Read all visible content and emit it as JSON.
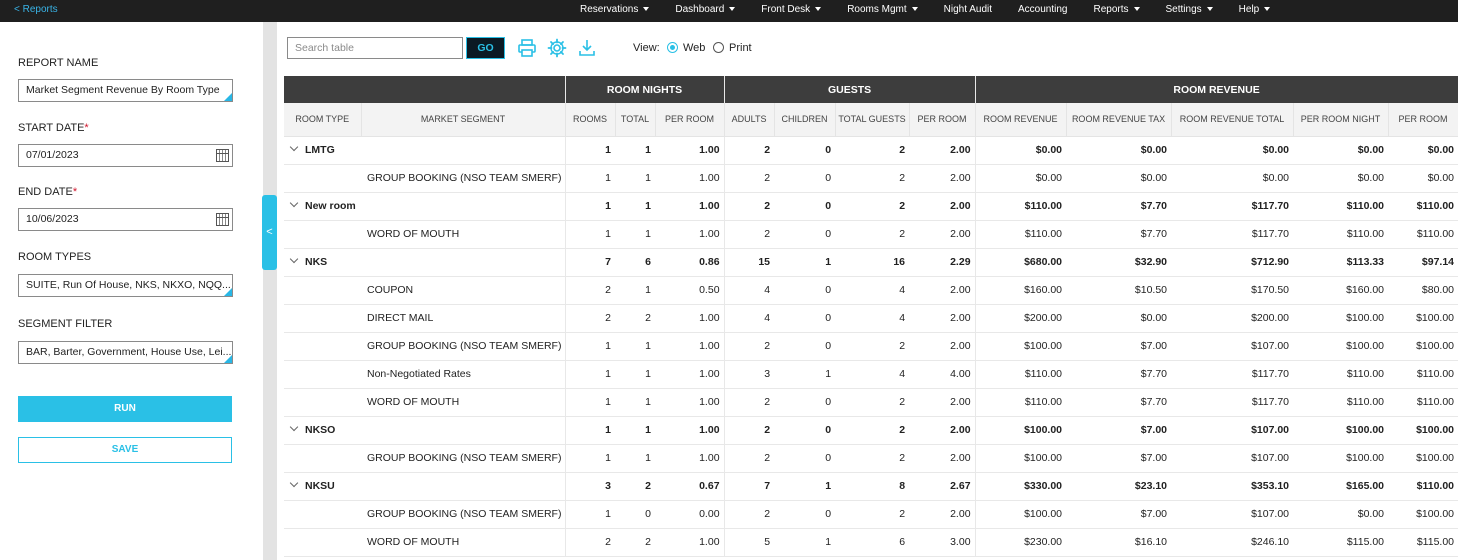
{
  "nav": {
    "back": "< Reports",
    "items": [
      "Reservations",
      "Dashboard",
      "Front Desk",
      "Rooms Mgmt",
      "Night Audit",
      "Accounting",
      "Reports",
      "Settings",
      "Help"
    ],
    "has_caret": [
      true,
      true,
      true,
      true,
      false,
      false,
      true,
      true,
      true
    ]
  },
  "sidebar": {
    "report_name_label": "REPORT NAME",
    "report_name_value": "Market Segment Revenue By Room Type",
    "start_date_label": "START DATE",
    "start_date_value": "07/01/2023",
    "end_date_label": "END DATE",
    "end_date_value": "10/06/2023",
    "required_mark": "*",
    "room_types_label": "ROOM TYPES",
    "room_types_value": "SUITE, Run Of House, NKS, NKXO, NQQ...",
    "segment_filter_label": "SEGMENT FILTER",
    "segment_filter_value": "BAR, Barter, Government, House Use, Lei...",
    "run_label": "RUN",
    "save_label": "SAVE",
    "collapse_glyph": "<"
  },
  "toolbar": {
    "search_placeholder": "Search table",
    "go_label": "GO",
    "view_label": "View:",
    "view_options": [
      "Web",
      "Print"
    ],
    "view_selected": "Web"
  },
  "colors": {
    "accent": "#2ac0e6",
    "nav_bg": "#1f1f1f",
    "header_bg": "#3d3d3d",
    "required": "#d0142b"
  },
  "table": {
    "groups": [
      "ROOM NIGHTS",
      "GUESTS",
      "ROOM REVENUE"
    ],
    "columns": [
      "ROOM TYPE",
      "MARKET SEGMENT",
      "ROOMS",
      "TOTAL",
      "PER ROOM",
      "ADULTS",
      "CHILDREN",
      "TOTAL GUESTS",
      "PER ROOM",
      "ROOM REVENUE",
      "ROOM REVENUE TAX",
      "ROOM REVENUE TOTAL",
      "PER ROOM NIGHT",
      "PER ROOM"
    ],
    "rows": [
      {
        "type": "parent",
        "room_type": "LMTG",
        "segment": "",
        "v": [
          "1",
          "1",
          "1.00",
          "2",
          "0",
          "2",
          "2.00",
          "$0.00",
          "$0.00",
          "$0.00",
          "$0.00",
          "$0.00"
        ]
      },
      {
        "type": "child",
        "room_type": "",
        "segment": "GROUP BOOKING (NSO TEAM SMERF)",
        "v": [
          "1",
          "1",
          "1.00",
          "2",
          "0",
          "2",
          "2.00",
          "$0.00",
          "$0.00",
          "$0.00",
          "$0.00",
          "$0.00"
        ]
      },
      {
        "type": "parent",
        "room_type": "New room",
        "segment": "",
        "v": [
          "1",
          "1",
          "1.00",
          "2",
          "0",
          "2",
          "2.00",
          "$110.00",
          "$7.70",
          "$117.70",
          "$110.00",
          "$110.00"
        ]
      },
      {
        "type": "child",
        "room_type": "",
        "segment": "WORD OF MOUTH",
        "v": [
          "1",
          "1",
          "1.00",
          "2",
          "0",
          "2",
          "2.00",
          "$110.00",
          "$7.70",
          "$117.70",
          "$110.00",
          "$110.00"
        ]
      },
      {
        "type": "parent",
        "room_type": "NKS",
        "segment": "",
        "v": [
          "7",
          "6",
          "0.86",
          "15",
          "1",
          "16",
          "2.29",
          "$680.00",
          "$32.90",
          "$712.90",
          "$113.33",
          "$97.14"
        ]
      },
      {
        "type": "child",
        "room_type": "",
        "segment": "COUPON",
        "v": [
          "2",
          "1",
          "0.50",
          "4",
          "0",
          "4",
          "2.00",
          "$160.00",
          "$10.50",
          "$170.50",
          "$160.00",
          "$80.00"
        ]
      },
      {
        "type": "child",
        "room_type": "",
        "segment": "DIRECT MAIL",
        "v": [
          "2",
          "2",
          "1.00",
          "4",
          "0",
          "4",
          "2.00",
          "$200.00",
          "$0.00",
          "$200.00",
          "$100.00",
          "$100.00"
        ]
      },
      {
        "type": "child",
        "room_type": "",
        "segment": "GROUP BOOKING (NSO TEAM SMERF)",
        "v": [
          "1",
          "1",
          "1.00",
          "2",
          "0",
          "2",
          "2.00",
          "$100.00",
          "$7.00",
          "$107.00",
          "$100.00",
          "$100.00"
        ]
      },
      {
        "type": "child",
        "room_type": "",
        "segment": "Non-Negotiated Rates",
        "v": [
          "1",
          "1",
          "1.00",
          "3",
          "1",
          "4",
          "4.00",
          "$110.00",
          "$7.70",
          "$117.70",
          "$110.00",
          "$110.00"
        ]
      },
      {
        "type": "child",
        "room_type": "",
        "segment": "WORD OF MOUTH",
        "v": [
          "1",
          "1",
          "1.00",
          "2",
          "0",
          "2",
          "2.00",
          "$110.00",
          "$7.70",
          "$117.70",
          "$110.00",
          "$110.00"
        ]
      },
      {
        "type": "parent",
        "room_type": "NKSO",
        "segment": "",
        "v": [
          "1",
          "1",
          "1.00",
          "2",
          "0",
          "2",
          "2.00",
          "$100.00",
          "$7.00",
          "$107.00",
          "$100.00",
          "$100.00"
        ]
      },
      {
        "type": "child",
        "room_type": "",
        "segment": "GROUP BOOKING (NSO TEAM SMERF)",
        "v": [
          "1",
          "1",
          "1.00",
          "2",
          "0",
          "2",
          "2.00",
          "$100.00",
          "$7.00",
          "$107.00",
          "$100.00",
          "$100.00"
        ]
      },
      {
        "type": "parent",
        "room_type": "NKSU",
        "segment": "",
        "v": [
          "3",
          "2",
          "0.67",
          "7",
          "1",
          "8",
          "2.67",
          "$330.00",
          "$23.10",
          "$353.10",
          "$165.00",
          "$110.00"
        ]
      },
      {
        "type": "child",
        "room_type": "",
        "segment": "GROUP BOOKING (NSO TEAM SMERF)",
        "v": [
          "1",
          "0",
          "0.00",
          "2",
          "0",
          "2",
          "2.00",
          "$100.00",
          "$7.00",
          "$107.00",
          "$0.00",
          "$100.00"
        ]
      },
      {
        "type": "child",
        "room_type": "",
        "segment": "WORD OF MOUTH",
        "v": [
          "2",
          "2",
          "1.00",
          "5",
          "1",
          "6",
          "3.00",
          "$230.00",
          "$16.10",
          "$246.10",
          "$115.00",
          "$115.00"
        ]
      }
    ]
  }
}
